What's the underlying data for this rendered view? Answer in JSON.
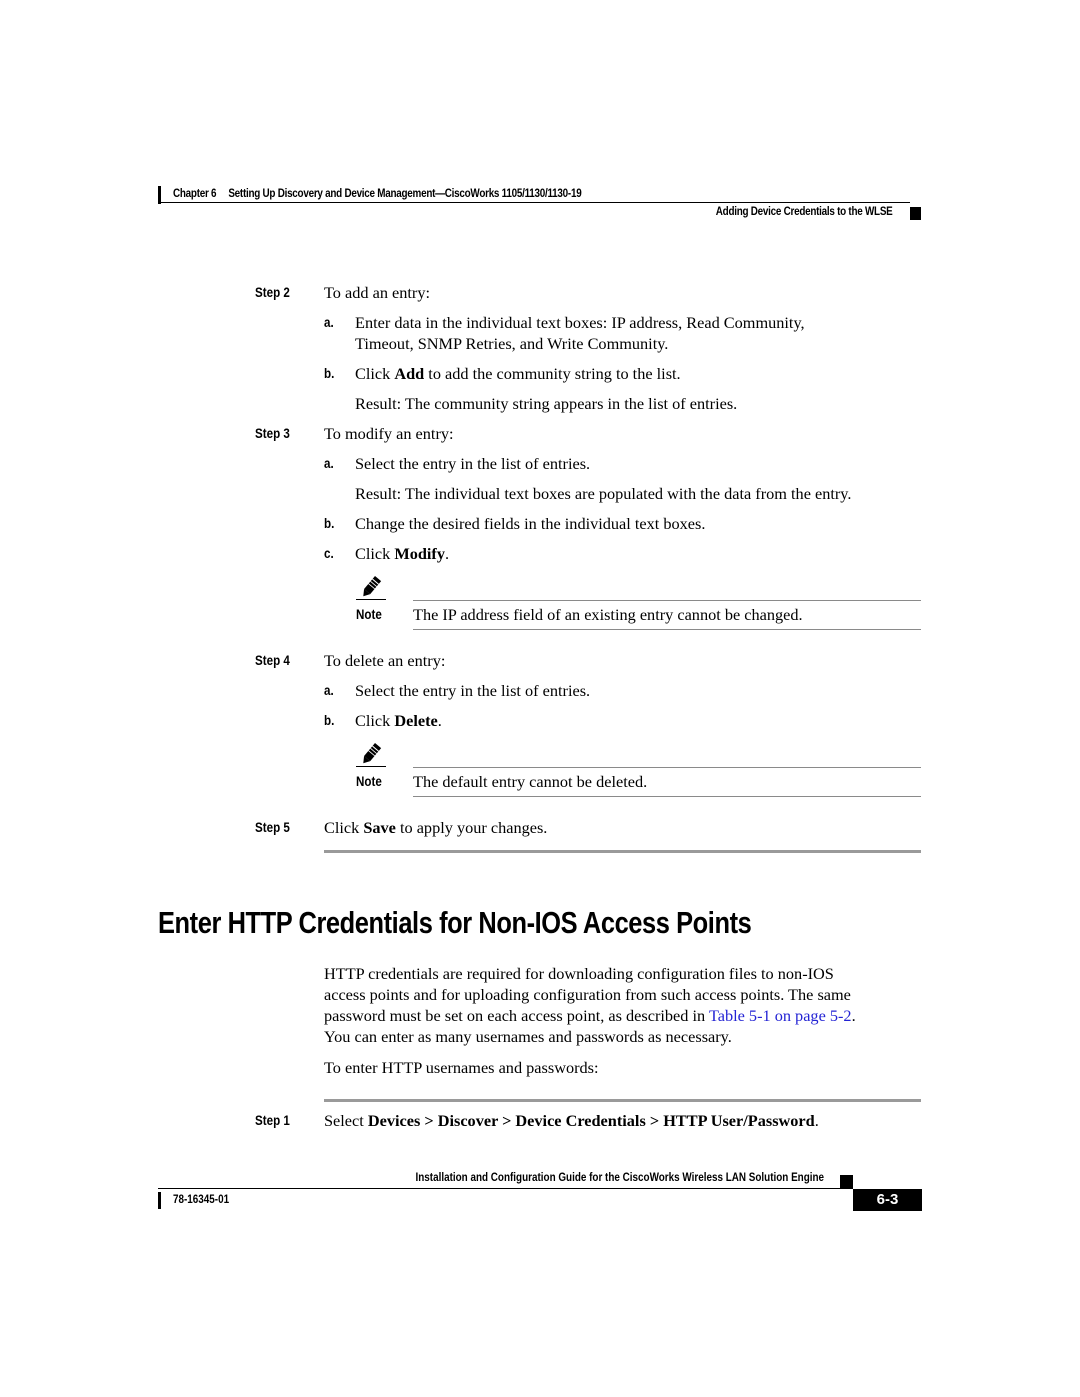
{
  "header": {
    "chapter": "Chapter 6",
    "chapter_title": "Setting Up Discovery and Device Management—CiscoWorks 1105/1130/1130-19",
    "section": "Adding Device Credentials to the WLSE"
  },
  "steps_a": [
    {
      "label": "Step 2",
      "text": "To add an entry:",
      "sub": {
        "a": {
          "letter": "a.",
          "line1": "Enter data in the individual text boxes: IP address, Read Community,",
          "line2": "Timeout, SNMP Retries, and Write Community."
        },
        "b": {
          "letter": "b.",
          "pre": "Click ",
          "bold": "Add",
          "post": " to add the community string to the list."
        },
        "result": "Result: The community string appears in the list of entries."
      }
    },
    {
      "label": "Step 3",
      "text": "To modify an entry:",
      "sub": {
        "a": {
          "letter": "a.",
          "text": "Select the entry in the list of entries."
        },
        "result": "Result: The individual text boxes are populated with the data from the entry.",
        "b": {
          "letter": "b.",
          "text": "Change the desired fields in the individual text boxes."
        },
        "c": {
          "letter": "c.",
          "pre": "Click ",
          "bold": "Modify",
          "post": "."
        }
      },
      "note": {
        "icon": "pencil-note-icon",
        "label": "Note",
        "text": "The IP address field of an existing entry cannot be changed."
      }
    },
    {
      "label": "Step 4",
      "text": "To delete an entry:",
      "sub": {
        "a": {
          "letter": "a.",
          "text": "Select the entry in the list of entries."
        },
        "b": {
          "letter": "b.",
          "pre": "Click ",
          "bold": "Delete",
          "post": "."
        }
      },
      "note": {
        "icon": "pencil-note-icon",
        "label": "Note",
        "text": "The default entry cannot be deleted."
      }
    },
    {
      "label": "Step 5",
      "pre": "Click ",
      "bold": "Save",
      "post": " to apply your changes."
    }
  ],
  "section_heading": "Enter HTTP Credentials for Non-IOS Access Points",
  "intro": {
    "line1": "HTTP credentials are required for downloading configuration files to non-IOS",
    "line2": "access points and for uploading configuration from such access points. The same",
    "line3_pre": "password must be set on each access point, as described in ",
    "line3_link": "Table 5-1 on page 5-2",
    "line3_post": ".",
    "line4": "You can enter as many usernames and passwords as necessary.",
    "lead": "To enter HTTP usernames and passwords:"
  },
  "steps_b": [
    {
      "label": "Step 1",
      "pre": "Select ",
      "path": "Devices > Discover > Device Credentials > HTTP User/Password",
      "post": "."
    }
  ],
  "colors": {
    "link": "#2323d4",
    "rule_gray": "#9a9a9a"
  },
  "footer": {
    "title": "Installation and Configuration Guide for the CiscoWorks Wireless LAN Solution Engine",
    "doc_number": "78-16345-01",
    "page": "6-3"
  }
}
